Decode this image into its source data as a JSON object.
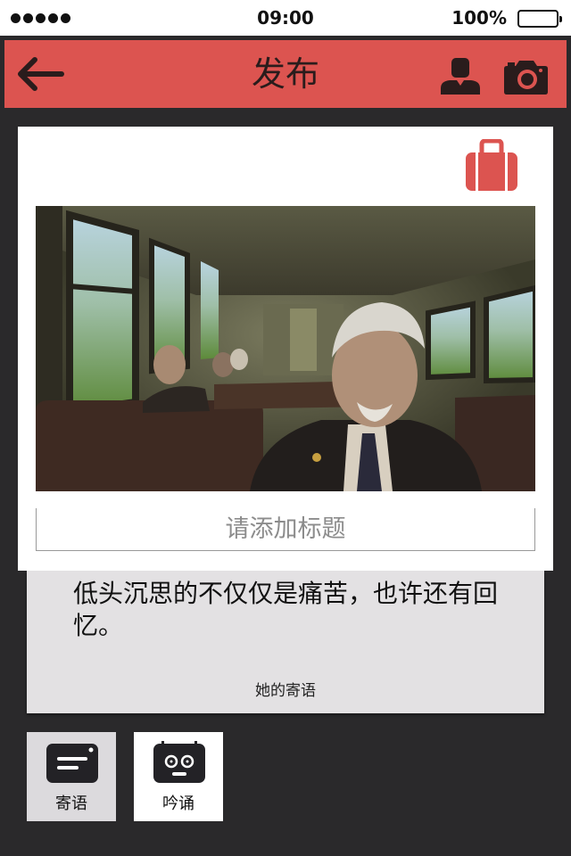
{
  "status_bar": {
    "time": "09:00",
    "battery": "100%"
  },
  "header": {
    "title": "发布",
    "color": "#dc5450"
  },
  "card": {
    "title_placeholder": "请添加标题"
  },
  "note": {
    "text": "低头沉思的不仅仅是痛苦，也许还有回忆。",
    "signature": "她的寄语"
  },
  "tools": [
    {
      "label": "寄语",
      "icon": "message-icon"
    },
    {
      "label": "吟诵",
      "icon": "recite-face-icon"
    }
  ],
  "colors": {
    "accent": "#dc5450",
    "background": "#2a292b",
    "panel": "#e3e1e3"
  }
}
